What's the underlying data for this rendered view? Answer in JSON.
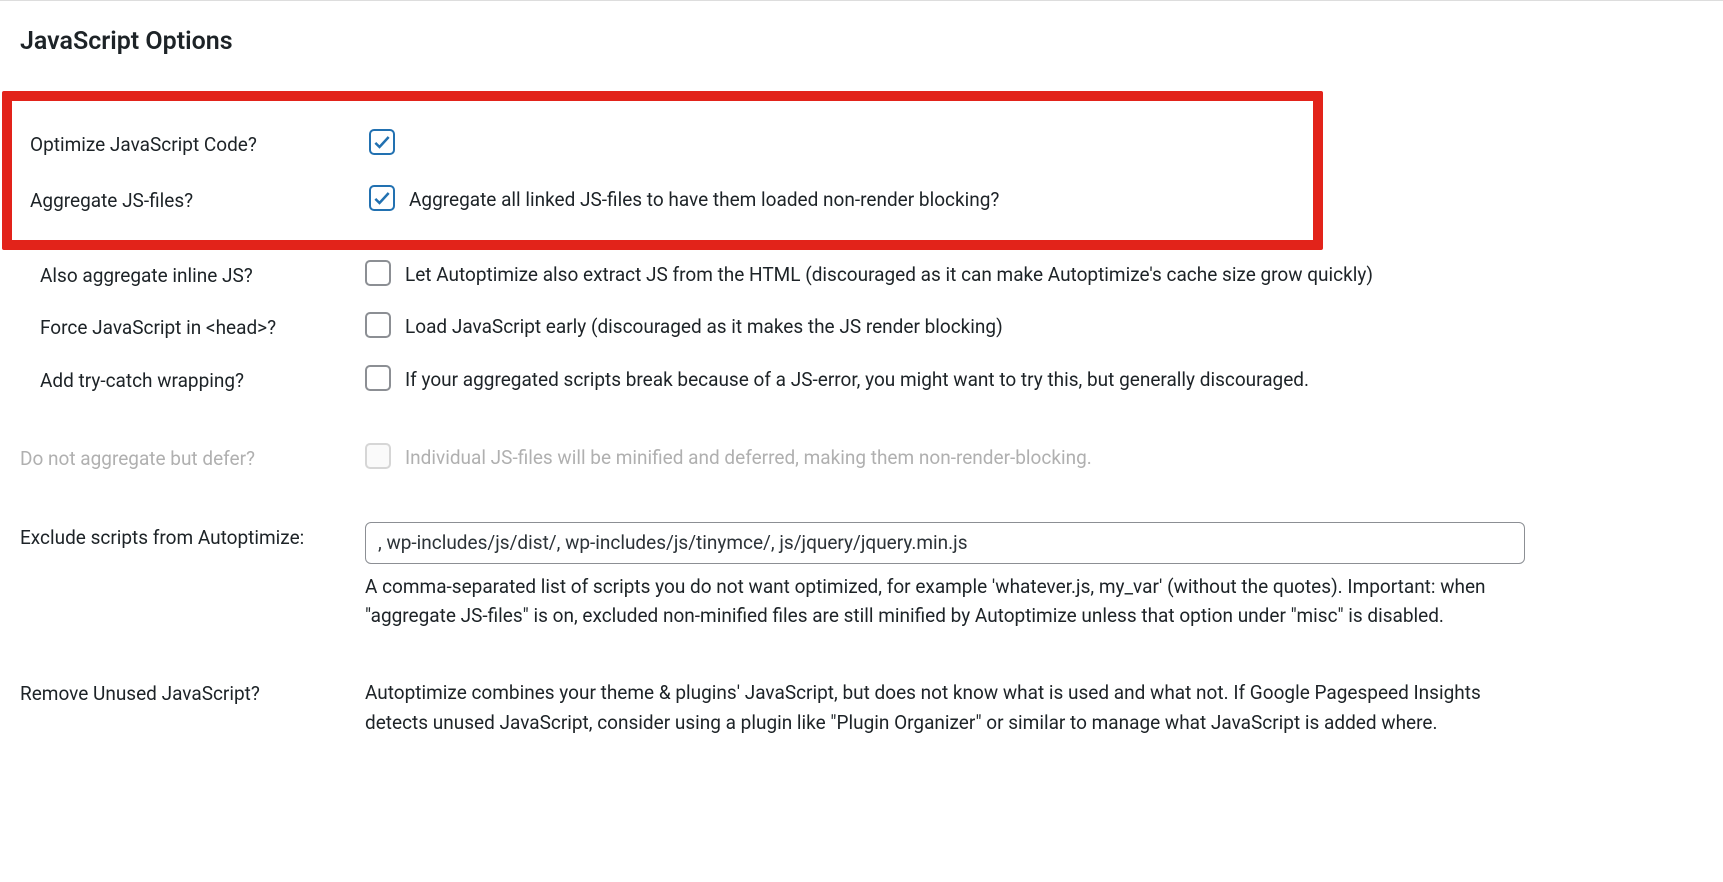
{
  "section": {
    "title": "JavaScript Options"
  },
  "rows": {
    "optimize": {
      "label": "Optimize JavaScript Code?",
      "checked": true,
      "desc": ""
    },
    "aggregate": {
      "label": "Aggregate JS-files?",
      "checked": true,
      "desc": "Aggregate all linked JS-files to have them loaded non-render blocking?"
    },
    "inline": {
      "label": "Also aggregate inline JS?",
      "checked": false,
      "desc": "Let Autoptimize also extract JS from the HTML (discouraged as it can make Autoptimize's cache size grow quickly)"
    },
    "head": {
      "label": "Force JavaScript in <head>?",
      "checked": false,
      "desc": "Load JavaScript early (discouraged as it makes the JS render blocking)"
    },
    "trycatch": {
      "label": "Add try-catch wrapping?",
      "checked": false,
      "desc": "If your aggregated scripts break because of a JS-error, you might want to try this, but generally discouraged."
    },
    "defer": {
      "label": "Do not aggregate but defer?",
      "checked": false,
      "disabled": true,
      "desc": "Individual JS-files will be minified and deferred, making them non-render-blocking."
    },
    "exclude": {
      "label": "Exclude scripts from Autoptimize:",
      "value": ", wp-includes/js/dist/, wp-includes/js/tinymce/, js/jquery/jquery.min.js",
      "help": "A comma-separated list of scripts you do not want optimized, for example 'whatever.js, my_var' (without the quotes). Important: when \"aggregate JS-files\" is on, excluded non-minified files are still minified by Autoptimize unless that option under \"misc\" is disabled."
    },
    "unused": {
      "label": "Remove Unused JavaScript?",
      "desc": "Autoptimize combines your theme & plugins' JavaScript, but does not know what is used and what not. If Google Pagespeed Insights detects unused JavaScript, consider using a plugin like \"Plugin Organizer\" or similar to manage what JavaScript is added where."
    }
  }
}
